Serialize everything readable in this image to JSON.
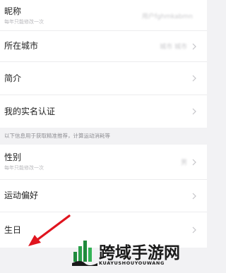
{
  "profile_rows_top": [
    {
      "label": "昵称",
      "sub": "每年只能修改一次",
      "value": "用户fghmkabmn",
      "chevron": false
    },
    {
      "label": "所在城市",
      "sub": "",
      "value": "城市 城市",
      "chevron": true
    },
    {
      "label": "简介",
      "sub": "",
      "value": "",
      "chevron": true
    },
    {
      "label": "我的实名认证",
      "sub": "",
      "value": "",
      "chevron": true
    }
  ],
  "section_note": "以下信息用于获取精准推荐，计算运动消耗等",
  "profile_rows_bottom": [
    {
      "label": "性别",
      "sub": "每年只能修改一次",
      "value": "男",
      "chevron": true
    },
    {
      "label": "运动偏好",
      "sub": "",
      "value": "",
      "chevron": true
    },
    {
      "label": "生日",
      "sub": "",
      "value": "",
      "chevron": true
    }
  ],
  "annotation": {
    "color": "#e0141e"
  },
  "watermark": {
    "name_cn": "跨域手游网",
    "name_en": "KUAYUSHOUYOUWANG"
  },
  "colors": {
    "background": "#f2f2f4",
    "card": "#ffffff",
    "text": "#222222",
    "subtext": "#b8b8bc",
    "note": "#8e8e93",
    "watermark_green": "#1f8a3c"
  },
  "icons": [
    "chevron-right-icon",
    "red-arrow",
    "watermark-logo"
  ]
}
